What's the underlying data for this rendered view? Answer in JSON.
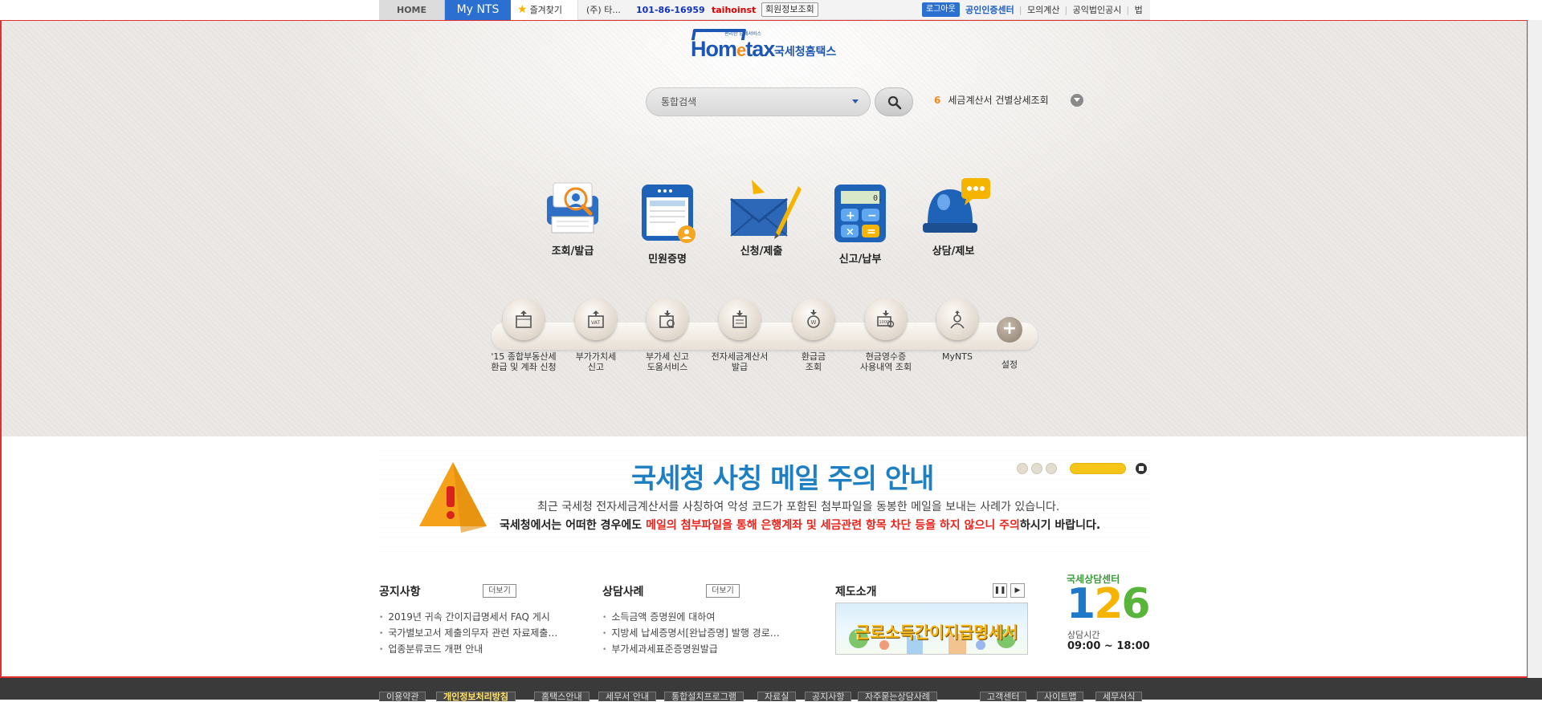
{
  "topbar": {
    "home": "HOME",
    "mynts": "My NTS",
    "favorites": "즐겨찾기",
    "company": "(주) 타...",
    "biz_no": "101-86-16959",
    "user_id": "taihoinst",
    "member_info": "회원정보조회",
    "logout": "로그아웃",
    "links": [
      "공인인증센터",
      "모의계산",
      "공익법인공시",
      "법령정보"
    ]
  },
  "logo": {
    "tagline": "편리한 납세서비스",
    "brand": "Hometax",
    "name": "국세청홈택스"
  },
  "search": {
    "label": "통합검색"
  },
  "ticker": {
    "rank": "6",
    "text": "세금계산서 건별상세조회"
  },
  "main_menu": [
    "조회/발급",
    "민원증명",
    "신청/제출",
    "신고/납부",
    "상담/제보"
  ],
  "quick_menu": [
    {
      "line1": "'15 종합부동산세",
      "line2": "환급 및 계좌 신청"
    },
    {
      "line1": "부가가치세",
      "line2": "신고"
    },
    {
      "line1": "부가세 신고",
      "line2": "도움서비스"
    },
    {
      "line1": "전자세금계산서",
      "line2": "발급"
    },
    {
      "line1": "환급금",
      "line2": "조회"
    },
    {
      "line1": "현금영수증",
      "line2": "사용내역 조회"
    },
    {
      "line1": "MyNTS",
      "line2": ""
    }
  ],
  "quick_settings": "설정",
  "notice": {
    "title": "국세청 사칭 메일 주의 안내",
    "desc": "최근 국세청 전자세금계산서를 사칭하여 악성 코드가 포함된 첨부파일을 동봉한 메일을 보내는 사례가 있습니다.",
    "warn_pre": "국세청에서는 어떠한 경우에도 ",
    "warn_red": "메일의 첨부파일을 통해 은행계좌 및 세금관련 항목 차단 등을 하지 않으니 주의",
    "warn_post": "하시기 바랍니다."
  },
  "notices": {
    "title": "공지사항",
    "more": "더보기",
    "items": [
      "2019년 귀속 간이지급명세서 FAQ 게시",
      "국가별보고서 제출의무자 관련 자료제출…",
      "업종분류코드 개편 안내"
    ]
  },
  "consult": {
    "title": "상담사례",
    "more": "더보기",
    "items": [
      "소득금액 증명원에 대하여",
      "지방세 납세증명서[완납증명] 발행 경로…",
      "부가세과세표준증명원발급"
    ]
  },
  "system": {
    "title": "제도소개",
    "banner_text": "근로소득간이지급명세서"
  },
  "call_center": {
    "title": "국세상담센터",
    "d1": "1",
    "d2": "2",
    "d3": "6",
    "hours_label": "상담시간",
    "hours": "09:00 ~ 18:00"
  },
  "footer": [
    "이용약관",
    "개인정보처리방침",
    "홈택스안내",
    "세무서 안내",
    "통합설치프로그램",
    "자료실",
    "공지사항",
    "자주묻는상담사례",
    "고객센터",
    "사이트맵",
    "세무서식"
  ]
}
